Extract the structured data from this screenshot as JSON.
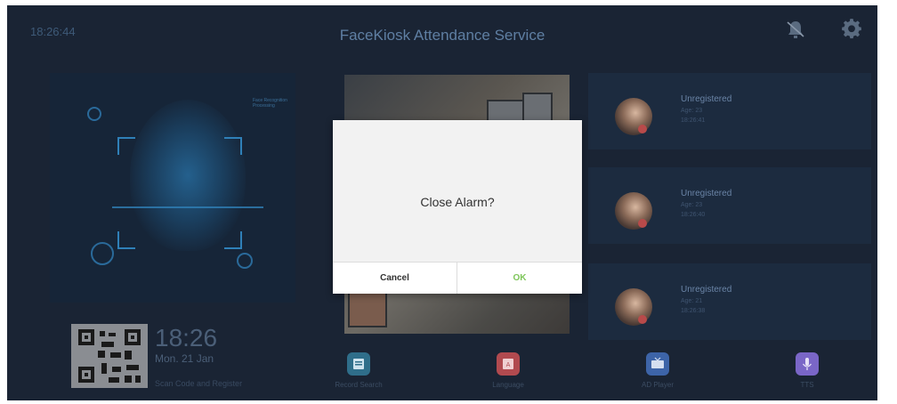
{
  "header": {
    "clock": "18:26:44",
    "title": "FaceKiosk Attendance Service",
    "alarm_icon": "alarm-bell-icon",
    "settings_icon": "gear-icon"
  },
  "scanner": {
    "hud_text": "Face Recognition Processing"
  },
  "register": {
    "time": "18:26",
    "date": "Mon. 21 Jan",
    "caption": "Scan Code and Register"
  },
  "records": [
    {
      "name": "Unregistered",
      "age": "Age: 23",
      "time": "18:26:41"
    },
    {
      "name": "Unregistered",
      "age": "Age: 23",
      "time": "18:26:40"
    },
    {
      "name": "Unregistered",
      "age": "Age: 21",
      "time": "18:26:38"
    }
  ],
  "bottom_nav": [
    {
      "label": "Record Search",
      "color": "#2f6e8a",
      "icon": "record-search-icon"
    },
    {
      "label": "Language",
      "color": "#b14a4f",
      "icon": "language-icon"
    },
    {
      "label": "AD Player",
      "color": "#3d64a8",
      "icon": "ad-player-icon"
    },
    {
      "label": "TTS",
      "color": "#7a66c7",
      "icon": "microphone-icon"
    }
  ],
  "dialog": {
    "message": "Close Alarm?",
    "cancel_label": "Cancel",
    "ok_label": "OK"
  },
  "colors": {
    "background": "#1a2434",
    "ok_green": "#7ec65a"
  }
}
